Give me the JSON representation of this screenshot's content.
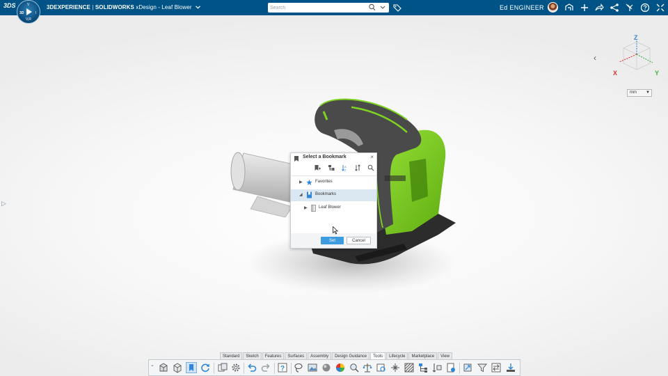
{
  "topbar": {
    "logo_text": "3DS",
    "compass": {
      "left": "3D",
      "top": "V",
      "right": "I",
      "bottom": "V,R"
    },
    "brand": "3DEXPERIENCE",
    "separator": "|",
    "app": "SOLIDWORKS",
    "doc_title": "xDesign - Leaf Blower",
    "search_placeholder": "Search",
    "user_name": "Ed ENGINEER",
    "right_icons": [
      "compass-share-icon",
      "add-icon",
      "share-arrow-icon",
      "network-share-icon",
      "tools-icon",
      "help-icon",
      "expand-icon"
    ]
  },
  "viewport": {
    "units": "mm",
    "cube_axes": {
      "z": "Z",
      "x": "X",
      "y": "Y"
    },
    "colors": {
      "axis_x": "#e2342c",
      "axis_y": "#3bb14a",
      "axis_z": "#2f86d6",
      "model_green": "#7ed321"
    }
  },
  "dialog": {
    "title": "Select a Bookmark",
    "close": "×",
    "tree": [
      {
        "label": "Favorites",
        "icon": "star-icon",
        "expanded": false,
        "selected": false
      },
      {
        "label": "Bookmarks",
        "icon": "bookmark-icon",
        "expanded": true,
        "selected": true
      },
      {
        "label": "Leaf Blower",
        "icon": "document-icon",
        "expanded": false,
        "selected": false
      }
    ],
    "set_label": "Set",
    "cancel_label": "Cancel"
  },
  "action_bar": {
    "tabs": [
      "Standard",
      "Sketch",
      "Features",
      "Surfaces",
      "Assembly",
      "Design Guidance",
      "Tools",
      "Lifecycle",
      "Marketplace",
      "View"
    ],
    "active_tab": "Tools"
  }
}
